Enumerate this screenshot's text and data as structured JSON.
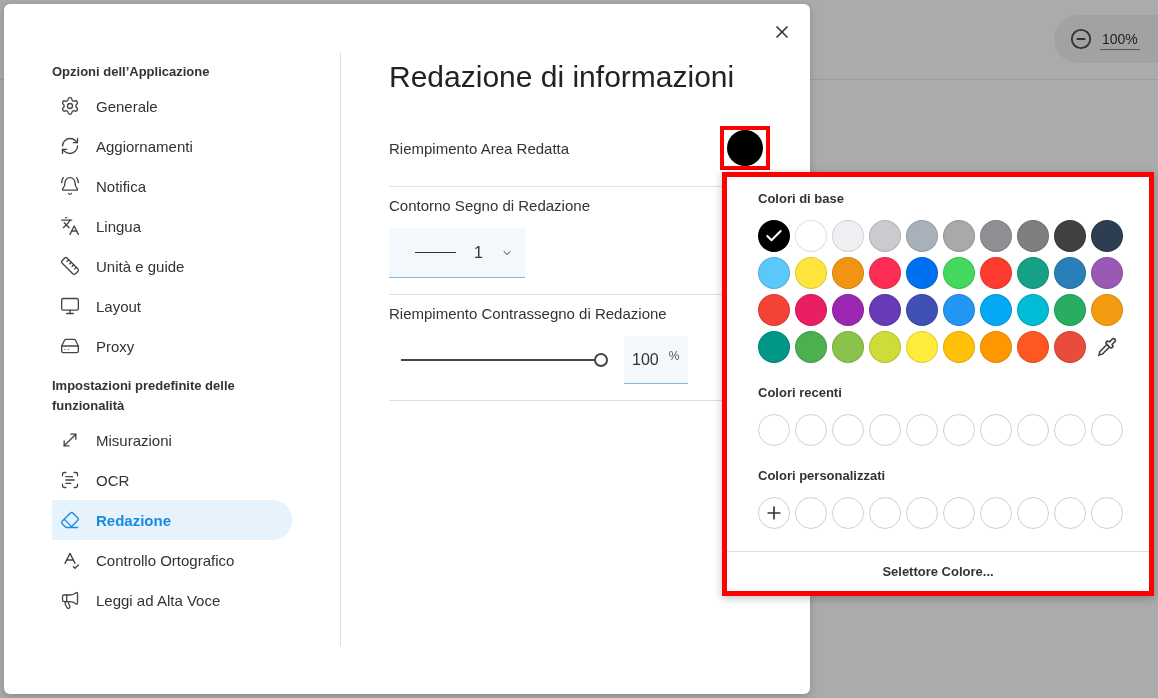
{
  "background": {
    "zoom": {
      "value": "100%"
    }
  },
  "dialog": {
    "sidebar": {
      "sections": [
        {
          "title": "Opzioni dell’Applicazione",
          "items": [
            {
              "label": "Generale",
              "selected": false
            },
            {
              "label": "Aggiornamenti",
              "selected": false
            },
            {
              "label": "Notifica",
              "selected": false
            },
            {
              "label": "Lingua",
              "selected": false
            },
            {
              "label": "Unità e guide",
              "selected": false
            },
            {
              "label": "Layout",
              "selected": false
            },
            {
              "label": "Proxy",
              "selected": false
            }
          ]
        },
        {
          "title": "Impostazioni predefinite delle funzionalità",
          "items": [
            {
              "label": "Misurazioni",
              "selected": false
            },
            {
              "label": "OCR",
              "selected": false
            },
            {
              "label": "Redazione",
              "selected": true
            },
            {
              "label": "Controllo Ortografico",
              "selected": false
            },
            {
              "label": "Leggi ad Alta Voce",
              "selected": false
            }
          ]
        }
      ]
    },
    "title": "Redazione di informazioni",
    "settings": [
      {
        "kind": "color",
        "label": "Riempimento Area Redatta",
        "color": "#000000"
      },
      {
        "kind": "stroke",
        "label": "Contorno Segno di Redazione",
        "value": "1"
      },
      {
        "kind": "opacity",
        "label": "Riempimento Contrassegno di Redazione",
        "level": 1,
        "value": "100",
        "unit": "%"
      }
    ]
  },
  "color_popover": {
    "basic_title": "Colori di base",
    "basic": [
      {
        "color": "#000000",
        "selected": true
      },
      {
        "color": "#ffffff",
        "selected": false
      },
      {
        "color": "#eeeef3",
        "selected": false
      },
      {
        "color": "#cbcbcf",
        "selected": false
      },
      {
        "color": "#a8b0b9",
        "selected": false
      },
      {
        "color": "#a9a9a9",
        "selected": false
      },
      {
        "color": "#8e8e93",
        "selected": false
      },
      {
        "color": "#7f7f7f",
        "selected": false
      },
      {
        "color": "#404040",
        "selected": false
      },
      {
        "color": "#2c3e50",
        "selected": false
      },
      {
        "color": "#5ac8fa",
        "selected": false
      },
      {
        "color": "#ffe53b",
        "selected": false
      },
      {
        "color": "#f39313",
        "selected": false
      },
      {
        "color": "#ff2d55",
        "selected": false
      },
      {
        "color": "#0070f3",
        "selected": false
      },
      {
        "color": "#44d85f",
        "selected": false
      },
      {
        "color": "#ff3b30",
        "selected": false
      },
      {
        "color": "#16a085",
        "selected": false
      },
      {
        "color": "#2980b9",
        "selected": false
      },
      {
        "color": "#9b59b6",
        "selected": false
      },
      {
        "color": "#f44336",
        "selected": false
      },
      {
        "color": "#e91e63",
        "selected": false
      },
      {
        "color": "#9c27b0",
        "selected": false
      },
      {
        "color": "#673ab7",
        "selected": false
      },
      {
        "color": "#3f51b5",
        "selected": false
      },
      {
        "color": "#2196f3",
        "selected": false
      },
      {
        "color": "#03a9f4",
        "selected": false
      },
      {
        "color": "#00bcd4",
        "selected": false
      },
      {
        "color": "#27ae60",
        "selected": false
      },
      {
        "color": "#f39c12",
        "selected": false
      },
      {
        "color": "#009688",
        "selected": false
      },
      {
        "color": "#4caf50",
        "selected": false
      },
      {
        "color": "#8bc34a",
        "selected": false
      },
      {
        "color": "#cddc39",
        "selected": false
      },
      {
        "color": "#ffeb3b",
        "selected": false
      },
      {
        "color": "#ffc107",
        "selected": false
      },
      {
        "color": "#ff9800",
        "selected": false
      },
      {
        "color": "#ff5722",
        "selected": false
      },
      {
        "color": "#e74c3c",
        "selected": false
      }
    ],
    "recent_title": "Colori recenti",
    "custom_title": "Colori personalizzati",
    "footer_button": "Selettore Colore..."
  }
}
